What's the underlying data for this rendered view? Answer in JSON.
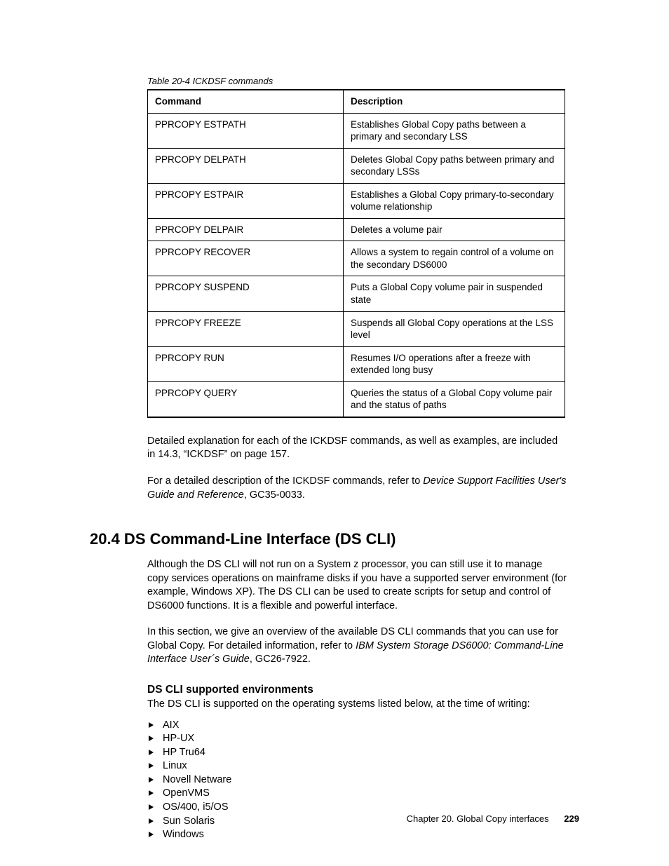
{
  "tableCaption": "Table 20-4   ICKDSF commands",
  "headers": {
    "cmd": "Command",
    "desc": "Description"
  },
  "rows": [
    {
      "cmd": "PPRCOPY ESTPATH",
      "desc": "Establishes Global Copy paths between a primary and secondary LSS"
    },
    {
      "cmd": "PPRCOPY DELPATH",
      "desc": "Deletes Global Copy paths between primary and secondary LSSs"
    },
    {
      "cmd": "PPRCOPY ESTPAIR",
      "desc": "Establishes a Global Copy primary-to-secondary volume relationship"
    },
    {
      "cmd": "PPRCOPY DELPAIR",
      "desc": "Deletes a volume pair"
    },
    {
      "cmd": "PPRCOPY RECOVER",
      "desc": "Allows a system to regain control of a volume on the secondary DS6000"
    },
    {
      "cmd": "PPRCOPY SUSPEND",
      "desc": "Puts a Global Copy volume pair in suspended state"
    },
    {
      "cmd": "PPRCOPY FREEZE",
      "desc": "Suspends all Global Copy operations at the LSS level"
    },
    {
      "cmd": "PPRCOPY RUN",
      "desc": "Resumes I/O operations after a freeze with extended long busy"
    },
    {
      "cmd": "PPRCOPY QUERY",
      "desc": "Queries the status of a Global Copy volume pair and the status of paths"
    }
  ],
  "para1": "Detailed explanation for each of the ICKDSF commands, as well as examples, are included in 14.3, “ICKDSF” on page 157.",
  "para2a": "For a detailed description of the ICKDSF commands, refer to ",
  "para2ref": "Device Support Facilities User's Guide and Reference",
  "para2b": ", GC35-0033.",
  "sectionHeading": "20.4  DS Command-Line Interface (DS CLI)",
  "para3": "Although the DS CLI will not run on a System z processor, you can still use it to manage copy services operations on mainframe disks if you have a supported server environment (for example, Windows XP). The DS CLI can be used to create scripts for setup and control of DS6000 functions. It is a flexible and powerful interface.",
  "para4a": "In this section, we give an overview of the available DS CLI commands that you can use for Global Copy. For detailed information, refer to ",
  "para4ref": "IBM System Storage DS6000: Command-Line Interface User´s Guide",
  "para4b": ", GC26-7922.",
  "subHeading": "DS CLI supported environments",
  "para5": "The DS CLI is supported on the operating systems listed below, at the time of writing:",
  "osList": [
    "AIX",
    "HP-UX",
    "HP Tru64",
    "Linux",
    "Novell Netware",
    "OpenVMS",
    "OS/400, i5/OS",
    "Sun Solaris",
    "Windows"
  ],
  "footerChapter": "Chapter 20. Global Copy interfaces",
  "footerPage": "229"
}
